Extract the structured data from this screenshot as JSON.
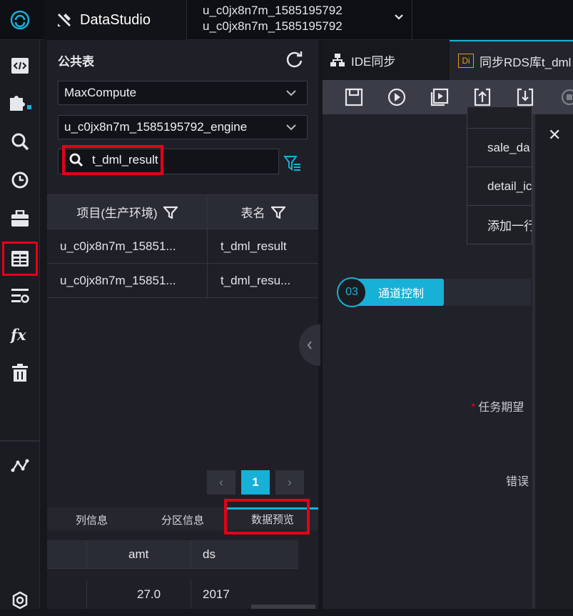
{
  "topbar": {
    "brand": "DataStudio",
    "project_line1": "u_c0jx8n7m_1585195792",
    "project_line2": "u_c0jx8n7m_1585195792"
  },
  "nav": {
    "icons": [
      "code-icon",
      "puzzle-icon",
      "search-icon",
      "clock-icon",
      "briefcase-icon",
      "table-icon",
      "list-settings-icon",
      "function-icon",
      "trash-icon",
      "graph-icon",
      "settings-icon"
    ]
  },
  "panel": {
    "title": "公共表",
    "engine_type": "MaxCompute",
    "engine_name": "u_c0jx8n7m_1585195792_engine",
    "search_value": "t_dml_result",
    "columns": [
      "项目(生产环境)",
      "表名"
    ],
    "rows": [
      {
        "project": "u_c0jx8n7m_15851...",
        "table": "t_dml_result"
      },
      {
        "project": "u_c0jx8n7m_15851...",
        "table": "t_dml_resu..."
      }
    ],
    "pager": {
      "prev": "‹",
      "current": "1",
      "next": "›"
    },
    "tabs": [
      "列信息",
      "分区信息",
      "数据预览"
    ],
    "preview": {
      "columns": [
        "amt",
        "ds"
      ],
      "rows": [
        [
          "27.0",
          "2017"
        ]
      ]
    }
  },
  "editor": {
    "tabs": [
      "IDE同步",
      "同步RDS库t_dml"
    ],
    "di_badge": "Di",
    "fields": [
      "sale_da",
      "detail_ic",
      "添加一行"
    ],
    "step_number": "03",
    "step_label": "通道控制",
    "label_expected": "任务期望",
    "label_error": "错误"
  },
  "colors": {
    "accent": "#17b0d6",
    "highlight": "#e4001a"
  }
}
